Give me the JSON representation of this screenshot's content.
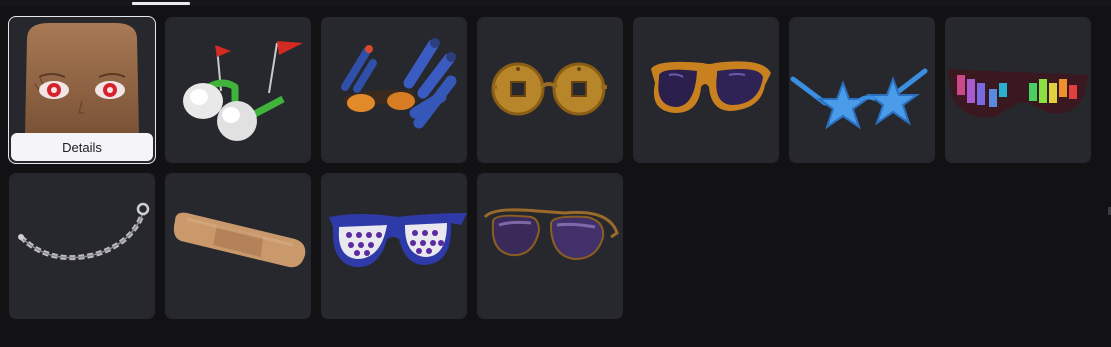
{
  "items": [
    {
      "icon": "bald-head-red-eyes-icon",
      "selected": true,
      "action_label": "Details"
    },
    {
      "icon": "flag-goggles-icon"
    },
    {
      "icon": "dart-blaster-shades-icon"
    },
    {
      "icon": "coin-glasses-icon"
    },
    {
      "icon": "orange-aviator-shades-icon"
    },
    {
      "icon": "blue-star-glasses-icon"
    },
    {
      "icon": "equalizer-shades-icon"
    },
    {
      "icon": "silver-chain-icon"
    },
    {
      "icon": "bandage-icon"
    },
    {
      "icon": "studded-shutter-shades-icon"
    },
    {
      "icon": "purple-aviator-shades-icon"
    }
  ],
  "colors": {
    "background": "#121215",
    "tile": "#27282d",
    "selected_outline": "#e8e8ec"
  }
}
